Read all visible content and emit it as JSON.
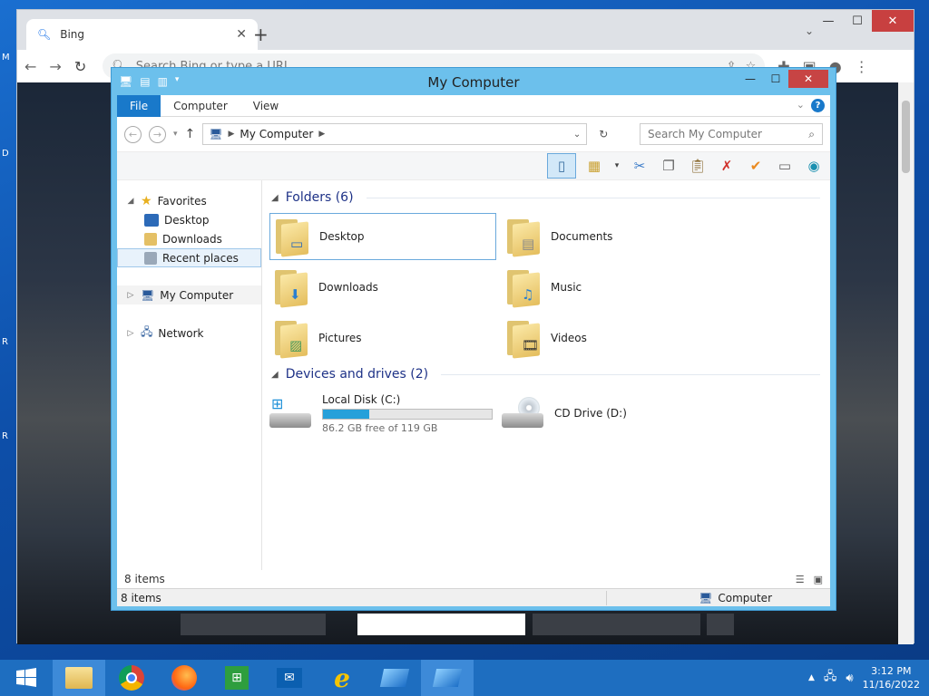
{
  "desktop": {
    "labels": [
      "M",
      "D",
      "R",
      "R"
    ]
  },
  "browser": {
    "tab_title": "Bing",
    "tab_close": "✕",
    "new_tab": "+",
    "omnibox_placeholder": "Search Bing or type a URL"
  },
  "window": {
    "title": "My Computer",
    "minimize": "—",
    "maximize": "☐",
    "close": "✕"
  },
  "ribbon": {
    "tabs": [
      "File",
      "Computer",
      "View"
    ],
    "help": "?"
  },
  "address": {
    "path": "My Computer",
    "search_placeholder": "Search My Computer"
  },
  "nav": {
    "favorites": "Favorites",
    "desktop": "Desktop",
    "downloads": "Downloads",
    "recent_places": "Recent places",
    "my_computer": "My Computer",
    "network": "Network"
  },
  "folders": {
    "header": "Folders (6)",
    "items": [
      "Desktop",
      "Documents",
      "Downloads",
      "Music",
      "Pictures",
      "Videos"
    ]
  },
  "drives": {
    "header": "Devices and drives (2)",
    "local": {
      "name": "Local Disk (C:)",
      "free_text": "86.2 GB free of 119 GB",
      "used_fraction": 0.276
    },
    "cd": {
      "name": "CD Drive (D:)"
    }
  },
  "status": {
    "items_count": "8 items",
    "status_items": "8 items",
    "location": "Computer"
  },
  "taskbar": {
    "time": "3:12 PM",
    "date": "11/16/2022"
  },
  "colors": {
    "accent": "#1979ca",
    "window_frame": "#6cc0ec",
    "taskbar": "#1e6ec0",
    "progress": "#26a0da"
  }
}
